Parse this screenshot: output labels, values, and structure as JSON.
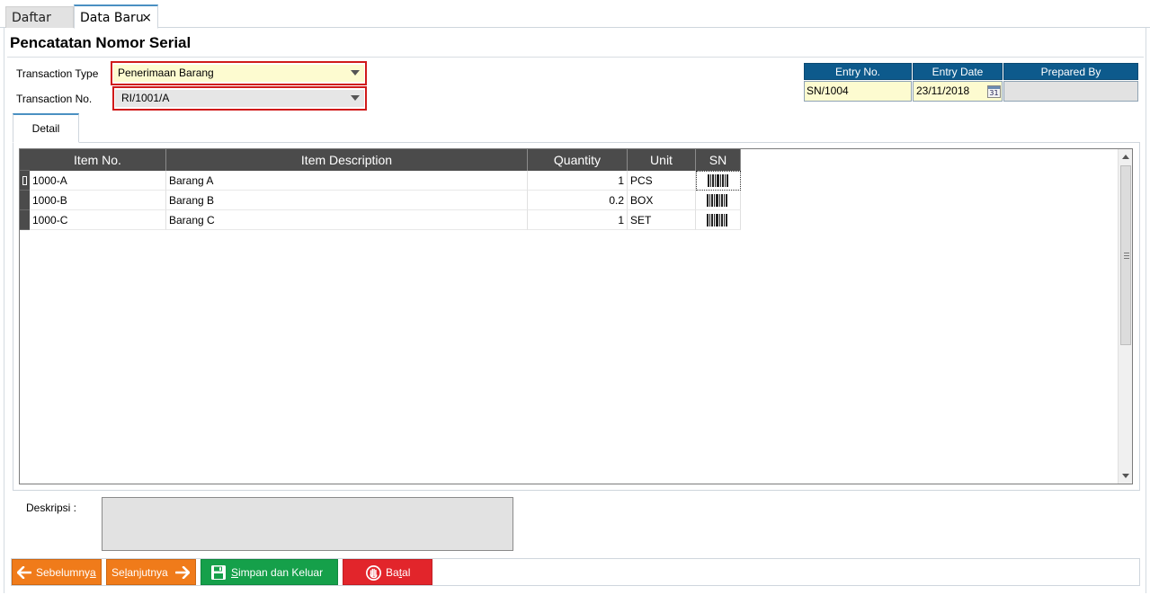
{
  "tabs": [
    {
      "label": "Daftar"
    },
    {
      "label": "Data Baru",
      "close": "×"
    }
  ],
  "page_title": "Pencatatan Nomor Serial",
  "form": {
    "transaction_type_label": "Transaction Type",
    "transaction_type_value": "Penerimaan Barang",
    "transaction_no_label": "Transaction No.",
    "transaction_no_value": "RI/1001/A"
  },
  "header_info": {
    "entry_no_label": "Entry No.",
    "entry_no_value": "SN/1004",
    "entry_date_label": "Entry Date",
    "entry_date_value": "23/11/2018",
    "calendar_day": "31",
    "prepared_by_label": "Prepared By",
    "prepared_by_value": ""
  },
  "detail_tab": "Detail",
  "grid": {
    "columns": [
      "Item No.",
      "Item Description",
      "Quantity",
      "Unit",
      "SN"
    ],
    "rows": [
      {
        "item_no": "1000-A",
        "description": "Barang A",
        "quantity": "1",
        "unit": "PCS"
      },
      {
        "item_no": "1000-B",
        "description": "Barang B",
        "quantity": "0.2",
        "unit": "BOX"
      },
      {
        "item_no": "1000-C",
        "description": "Barang C",
        "quantity": "1",
        "unit": "SET"
      }
    ]
  },
  "description_label": "Deskripsi :",
  "buttons": {
    "prev": {
      "pre": "Sebelumny",
      "key": "a",
      "post": ""
    },
    "next": {
      "pre": "Se",
      "key": "l",
      "post": "anjutnya"
    },
    "save": {
      "pre": "",
      "key": "S",
      "post": "impan dan Keluar"
    },
    "cancel": {
      "pre": "Ba",
      "key": "t",
      "post": "al"
    }
  },
  "colors": {
    "header_blue": "#0d5a8c",
    "highlight_red": "#d01a1a",
    "orange": "#f07b1a",
    "green": "#15a04a",
    "red": "#e2252b",
    "yellow_field": "#fdfbd0"
  }
}
